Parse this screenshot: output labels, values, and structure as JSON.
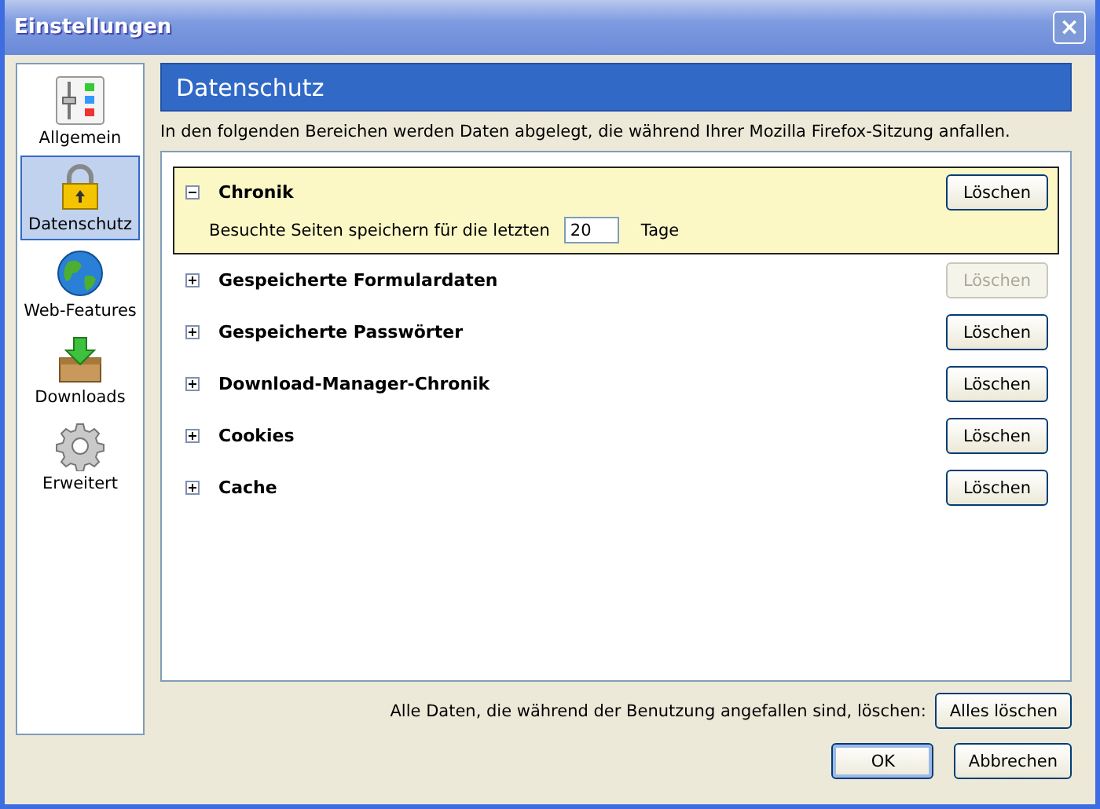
{
  "window": {
    "title": "Einstellungen",
    "close": "×"
  },
  "sidebar": {
    "items": [
      {
        "kind": "general",
        "label": "Allgemein",
        "selected": false
      },
      {
        "kind": "privacy",
        "label": "Datenschutz",
        "selected": true
      },
      {
        "kind": "web",
        "label": "Web-Features",
        "selected": false
      },
      {
        "kind": "downloads",
        "label": "Downloads",
        "selected": false
      },
      {
        "kind": "advanced",
        "label": "Erweitert",
        "selected": false
      }
    ]
  },
  "panel": {
    "title": "Datenschutz",
    "description": "In den folgenden Bereichen werden Daten abgelegt, die während Ihrer Mozilla Firefox-Sitzung anfallen.",
    "sections": [
      {
        "label": "Chronik",
        "expanded": true,
        "button": {
          "label": "Löschen",
          "disabled": false
        },
        "detail": {
          "label": "Besuchte Seiten speichern für die letzten",
          "value": "20",
          "unit": "Tage"
        }
      },
      {
        "label": "Gespeicherte Formulardaten",
        "expanded": false,
        "button": {
          "label": "Löschen",
          "disabled": true
        }
      },
      {
        "label": "Gespeicherte Passwörter",
        "expanded": false,
        "button": {
          "label": "Löschen",
          "disabled": false
        }
      },
      {
        "label": "Download-Manager-Chronik",
        "expanded": false,
        "button": {
          "label": "Löschen",
          "disabled": false
        }
      },
      {
        "label": "Cookies",
        "expanded": false,
        "button": {
          "label": "Löschen",
          "disabled": false
        }
      },
      {
        "label": "Cache",
        "expanded": false,
        "button": {
          "label": "Löschen",
          "disabled": false
        }
      }
    ]
  },
  "clear_all": {
    "label": "Alle Daten, die während der Benutzung angefallen sind, löschen:",
    "button": "Alles löschen"
  },
  "buttons": [
    {
      "label": "OK",
      "kind": "default"
    },
    {
      "label": "Abbrechen",
      "kind": "normal"
    }
  ]
}
